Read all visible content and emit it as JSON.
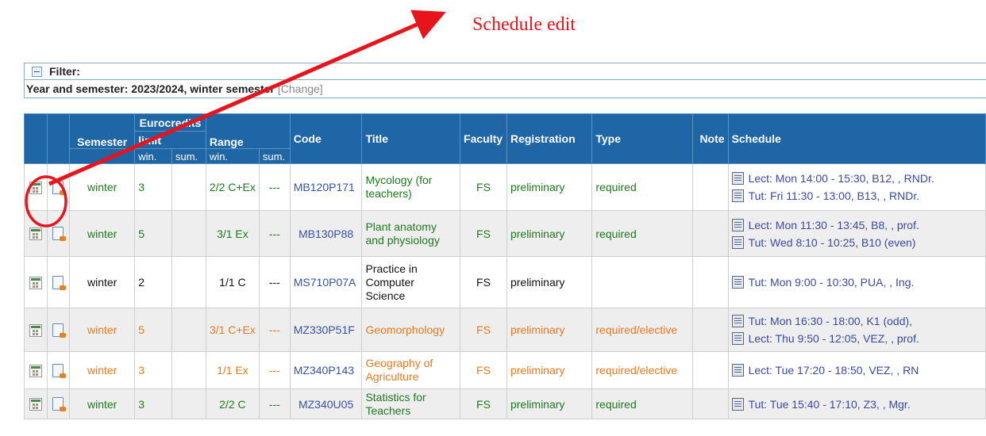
{
  "annotation": {
    "label": "Schedule edit",
    "color": "#e8141c"
  },
  "filter": {
    "label": "Filter:"
  },
  "semester": {
    "label": "Year and semester: 2023/2024, winter semester",
    "change": "[Change]"
  },
  "columns": {
    "semester": "Semester",
    "eurocredits": "Eurocredits",
    "limit": "limit",
    "range": "Range",
    "code": "Code",
    "title": "Title",
    "faculty": "Faculty",
    "registration": "Registration",
    "type": "Type",
    "note": "Note",
    "schedule": "Schedule",
    "win": "win.",
    "sum": "sum."
  },
  "rows": [
    {
      "semester": "winter",
      "limit": "3",
      "range_win": "2/2 C+Ex",
      "range_sum": "---",
      "code": "MB120P171",
      "title": "Mycology (for teachers)",
      "faculty": "FS",
      "registration": "preliminary",
      "type": "required",
      "schedule": [
        "Lect: Mon 14:00 - 15:30, B12, , RNDr.",
        "Tut: Fri 11:30 - 13:00, B13, , RNDr."
      ]
    },
    {
      "semester": "winter",
      "limit": "5",
      "range_win": "3/1 Ex",
      "range_sum": "---",
      "code": "MB130P88",
      "title": "Plant anatomy and physiology",
      "faculty": "FS",
      "registration": "preliminary",
      "type": "required",
      "schedule": [
        "Lect: Mon 11:30 - 13:45, B8, , prof.",
        "Tut: Wed 8:10 - 10:25, B10 (even)"
      ]
    },
    {
      "semester": "winter",
      "limit": "2",
      "range_win": "1/1 C",
      "range_sum": "---",
      "code": "MS710P07A",
      "title": "Practice in Computer Science",
      "faculty": "FS",
      "registration": "preliminary",
      "type": "",
      "schedule": [
        "Tut: Mon 9:00 - 10:30, PUA, , Ing."
      ]
    },
    {
      "semester": "winter",
      "limit": "5",
      "range_win": "3/1 C+Ex",
      "range_sum": "---",
      "code": "MZ330P51F",
      "title": "Geomorphology",
      "faculty": "FS",
      "registration": "preliminary",
      "type": "required/elective",
      "schedule": [
        "Tut: Mon 16:30 - 18:00, K1 (odd),",
        "Lect: Thu 9:50 - 12:05, VEZ, , prof."
      ]
    },
    {
      "semester": "winter",
      "limit": "3",
      "range_win": "1/1 Ex",
      "range_sum": "---",
      "code": "MZ340P143",
      "title": "Geography of Agriculture",
      "faculty": "FS",
      "registration": "preliminary",
      "type": "required/elective",
      "schedule": [
        "Lect: Tue 17:20 - 18:50, VEZ, , RN"
      ]
    },
    {
      "semester": "winter",
      "limit": "3",
      "range_win": "2/2 C",
      "range_sum": "---",
      "code": "MZ340U05",
      "title": "Statistics for Teachers",
      "faculty": "FS",
      "registration": "preliminary",
      "type": "required",
      "schedule": [
        "Tut: Tue 15:40 - 17:10, Z3, , Mgr."
      ]
    }
  ]
}
